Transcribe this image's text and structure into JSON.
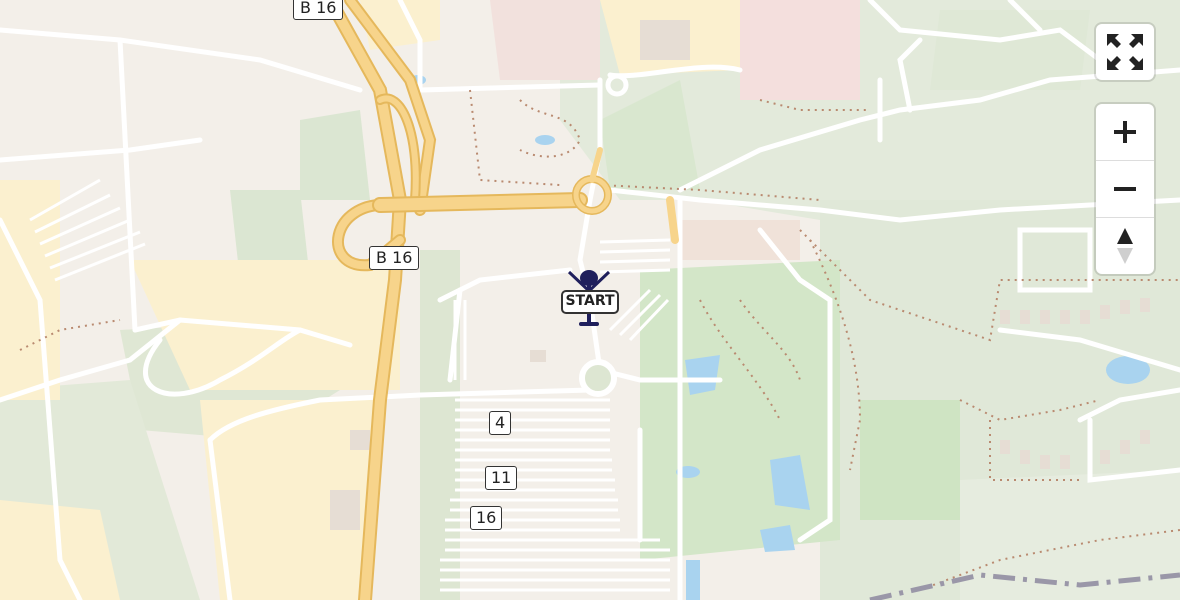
{
  "map": {
    "road_labels": {
      "b16_top": "B 16",
      "b16_middle": "B 16"
    },
    "parking_labels": {
      "p4": "4",
      "p11": "11",
      "p16": "16"
    },
    "start_marker": {
      "label": "START"
    },
    "colors": {
      "land": "#f3efe9",
      "green": "#dfe8d6",
      "park": "#cfe5c4",
      "yellow": "#fbf0cf",
      "pink": "#f4dede",
      "highway": "#f7d48b",
      "water": "#a9d3ef",
      "marker": "#1f1f5c"
    }
  },
  "controls": {
    "fullscreen_icon": "fullscreen-icon",
    "zoom_in_icon": "plus-icon",
    "zoom_out_icon": "minus-icon",
    "compass_icon": "compass-icon"
  }
}
